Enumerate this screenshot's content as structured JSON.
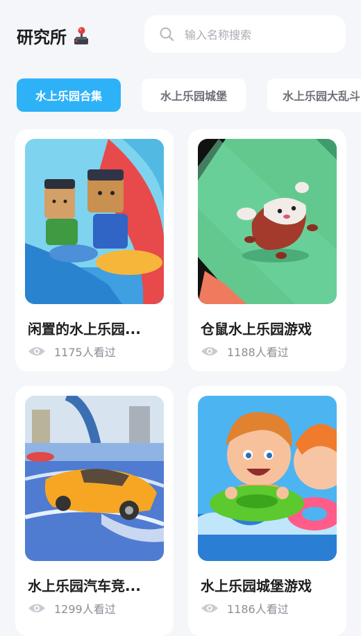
{
  "header": {
    "title": "研究所",
    "title_icon": "joystick-icon",
    "search_placeholder": "输入名称搜索"
  },
  "tabs": [
    {
      "label": "水上乐园合集",
      "active": true
    },
    {
      "label": "水上乐园城堡",
      "active": false
    },
    {
      "label": "水上乐园大乱斗",
      "active": false
    }
  ],
  "games": [
    {
      "title": "闲置的水上乐园...",
      "views": "1175人看过"
    },
    {
      "title": "仓鼠水上乐园游戏",
      "views": "1188人看过"
    },
    {
      "title": "水上乐园汽车竞...",
      "views": "1299人看过"
    },
    {
      "title": "水上乐园城堡游戏",
      "views": "1186人看过"
    }
  ],
  "colors": {
    "accent": "#2eb2f7",
    "background": "#f4f6f9",
    "muted_text": "#8b8e95"
  }
}
